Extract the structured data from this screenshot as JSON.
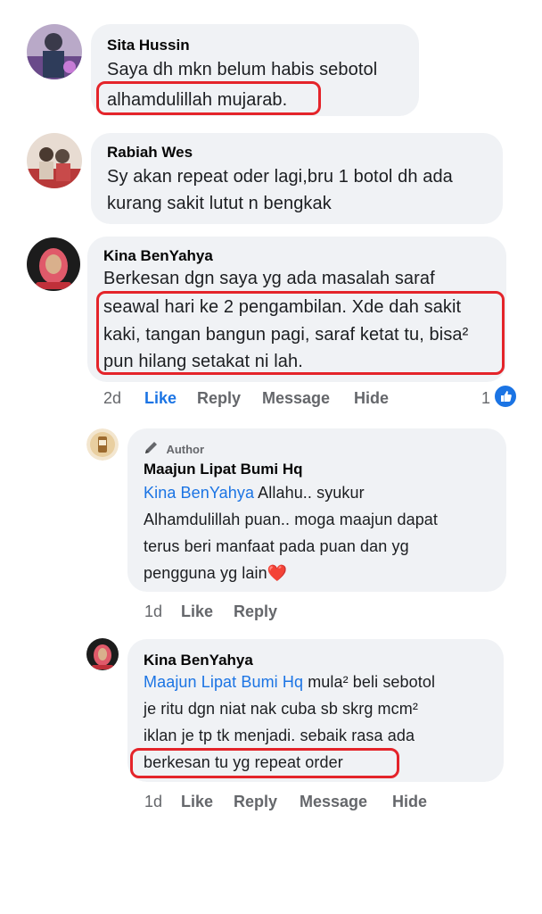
{
  "comments": [
    {
      "author": "Sita Hussin",
      "lines": [
        "Saya dh mkn belum habis sebotol",
        "alhamdulillah mujarab."
      ]
    },
    {
      "author": "Rabiah Wes",
      "lines": [
        "Sy akan repeat oder lagi,bru 1 botol dh ada",
        "kurang sakit lutut n bengkak"
      ]
    },
    {
      "author": "Kina BenYahya",
      "lines": [
        "Berkesan dgn saya yg ada masalah saraf",
        "seawal hari ke 2 pengambilan. Xde dah sakit",
        "kaki, tangan bangun pagi, saraf ketat tu, bisa²",
        "pun hilang setakat ni lah."
      ],
      "actions": {
        "time": "2d",
        "like": "Like",
        "reply": "Reply",
        "message": "Message",
        "hide": "Hide"
      },
      "reaction_count": "1"
    },
    {
      "badge": "Author",
      "author": "Maajun Lipat Bumi Hq",
      "mention": "Kina BenYahya",
      "lines": [
        " Allahu.. syukur",
        "Alhamdulillah puan.. moga maajun dapat",
        "terus beri manfaat pada puan dan yg",
        "pengguna yg lain"
      ],
      "emoji": "❤️",
      "actions": {
        "time": "1d",
        "like": "Like",
        "reply": "Reply"
      }
    },
    {
      "author": "Kina BenYahya",
      "mention": "Maajun Lipat Bumi Hq",
      "lines": [
        " mula² beli sebotol",
        "je ritu dgn niat nak cuba sb skrg mcm²",
        "iklan je tp tk menjadi. sebaik rasa ada",
        "berkesan tu yg repeat order"
      ],
      "actions": {
        "time": "1d",
        "like": "Like",
        "reply": "Reply",
        "message": "Message",
        "hide": "Hide"
      }
    }
  ],
  "colors": {
    "link": "#1b74e4",
    "highlight": "#e4242a",
    "bubble": "#f0f2f5"
  }
}
